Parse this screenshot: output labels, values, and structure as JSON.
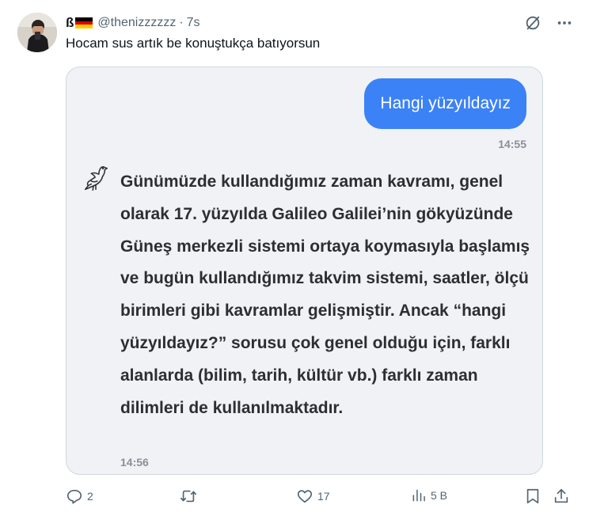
{
  "author": {
    "name": "ß",
    "flag_colors": [
      "#000000",
      "#dd0000",
      "#ffce00"
    ],
    "handle": "@thenizzzzzz",
    "separator": "·",
    "time": "7s"
  },
  "tweet": {
    "text": "Hocam sus artık be konuştukça batıyorsun"
  },
  "chat": {
    "user_message": "Hangi yüzyıldayız",
    "user_time": "14:55",
    "bot_message": "Günümüzde kullandığımız zaman kavramı, genel olarak 17. yüzyılda Galileo Galilei’nin gökyüzünde Güneş merkezli sistemi ortaya koymasıyla başlamış ve bugün kullandığımız takvim sistemi, saatler, ölçü birimleri gibi kavramlar gelişmiştir. Ancak “hangi yüzyıldayız?” sorusu çok genel olduğu için, farklı alanlarda (bilim, tarih, kültür vb.) farklı zaman dilimleri de kullanılmaktadır.",
    "bot_time": "14:56",
    "user_bubble_color": "#3b82f6",
    "bot_icon": "dove-icon"
  },
  "actions": {
    "reply_count": "2",
    "retweet_count": "",
    "like_count": "17",
    "views_count": "5 B"
  },
  "icons": {
    "grok": "grok-slash-icon",
    "more": "more-dots-icon",
    "reply": "reply-icon",
    "retweet": "retweet-icon",
    "like": "heart-icon",
    "views": "views-chart-icon",
    "bookmark": "bookmark-icon",
    "share": "share-icon"
  }
}
